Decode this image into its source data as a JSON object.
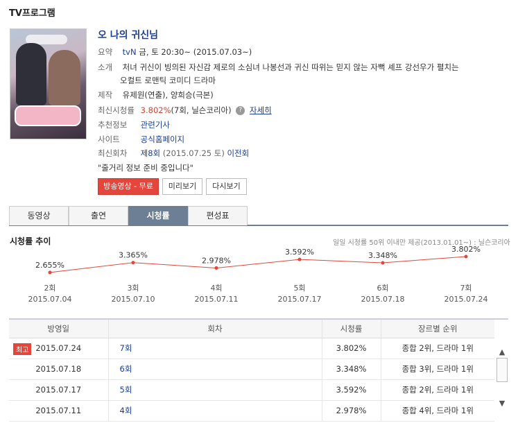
{
  "section_title": "TV프로그램",
  "program": {
    "title": "오 나의 귀신님",
    "rows": {
      "summary": {
        "label": "요약",
        "channel": "tvN",
        "text": "금, 토 20:30~ (2015.07.03~)"
      },
      "synopsis": {
        "label": "소개",
        "line1": "처녀 귀신이 빙의된 자신감 제로의 소심녀 나봉선과 귀신 따위는 믿지 않는 자뻑 셰프 강선우가 펼치는",
        "line2": "오컬트 로맨틱 코미디 드라마"
      },
      "staff": {
        "label": "제작",
        "text": "유제원(연출), 양희승(극본)"
      },
      "rating": {
        "label": "최신시청률",
        "value": "3.802%",
        "rest": "(7회, 닐슨코리아)",
        "help": "?",
        "link": "자세히"
      },
      "recommend": {
        "label": "추천정보",
        "link": "관련기사"
      },
      "site": {
        "label": "사이트",
        "link": "공식홈페이지"
      },
      "latest": {
        "label": "최신회차",
        "ep": "제8회",
        "date": "(2015.07.25 토)",
        "prev": "이전회"
      }
    },
    "quote": "\"줄거리 정보 준비 중입니다\""
  },
  "buttons": {
    "broadcast": "방송영상 - 무료",
    "preview": "미리보기",
    "replay": "다시보기"
  },
  "tabs": [
    "동영상",
    "출연",
    "시청률",
    "편성표"
  ],
  "chart_title": "시청률 추이",
  "chart_note": "일일 시청률 50위 이내만 제공(2013.01.01~) : 닐슨코리아",
  "chart_data": {
    "type": "line",
    "color": "#e4463b",
    "categories": [
      "2회",
      "3회",
      "4회",
      "5회",
      "6회",
      "7회"
    ],
    "dates": [
      "2015.07.04",
      "2015.07.10",
      "2015.07.11",
      "2015.07.17",
      "2015.07.18",
      "2015.07.24"
    ],
    "values": [
      2.655,
      3.365,
      2.978,
      3.592,
      3.348,
      3.802
    ],
    "labels": [
      "2.655%",
      "3.365%",
      "2.978%",
      "3.592%",
      "3.348%",
      "3.802%"
    ]
  },
  "table": {
    "headers": [
      "방영일",
      "회차",
      "시청률",
      "장르별 순위"
    ],
    "rows": [
      {
        "badge": "최고",
        "date": "2015.07.24",
        "ep": "7회",
        "rating": "3.802%",
        "rank": "종합 2위, 드라마 1위"
      },
      {
        "badge": "",
        "date": "2015.07.18",
        "ep": "6회",
        "rating": "3.348%",
        "rank": "종합 3위, 드라마 1위"
      },
      {
        "badge": "",
        "date": "2015.07.17",
        "ep": "5회",
        "rating": "3.592%",
        "rank": "종합 2위, 드라마 1위"
      },
      {
        "badge": "",
        "date": "2015.07.11",
        "ep": "4회",
        "rating": "2.978%",
        "rank": "종합 4위, 드라마 1위"
      }
    ]
  },
  "scrollbar": {
    "up": "▲",
    "down": "▼"
  }
}
